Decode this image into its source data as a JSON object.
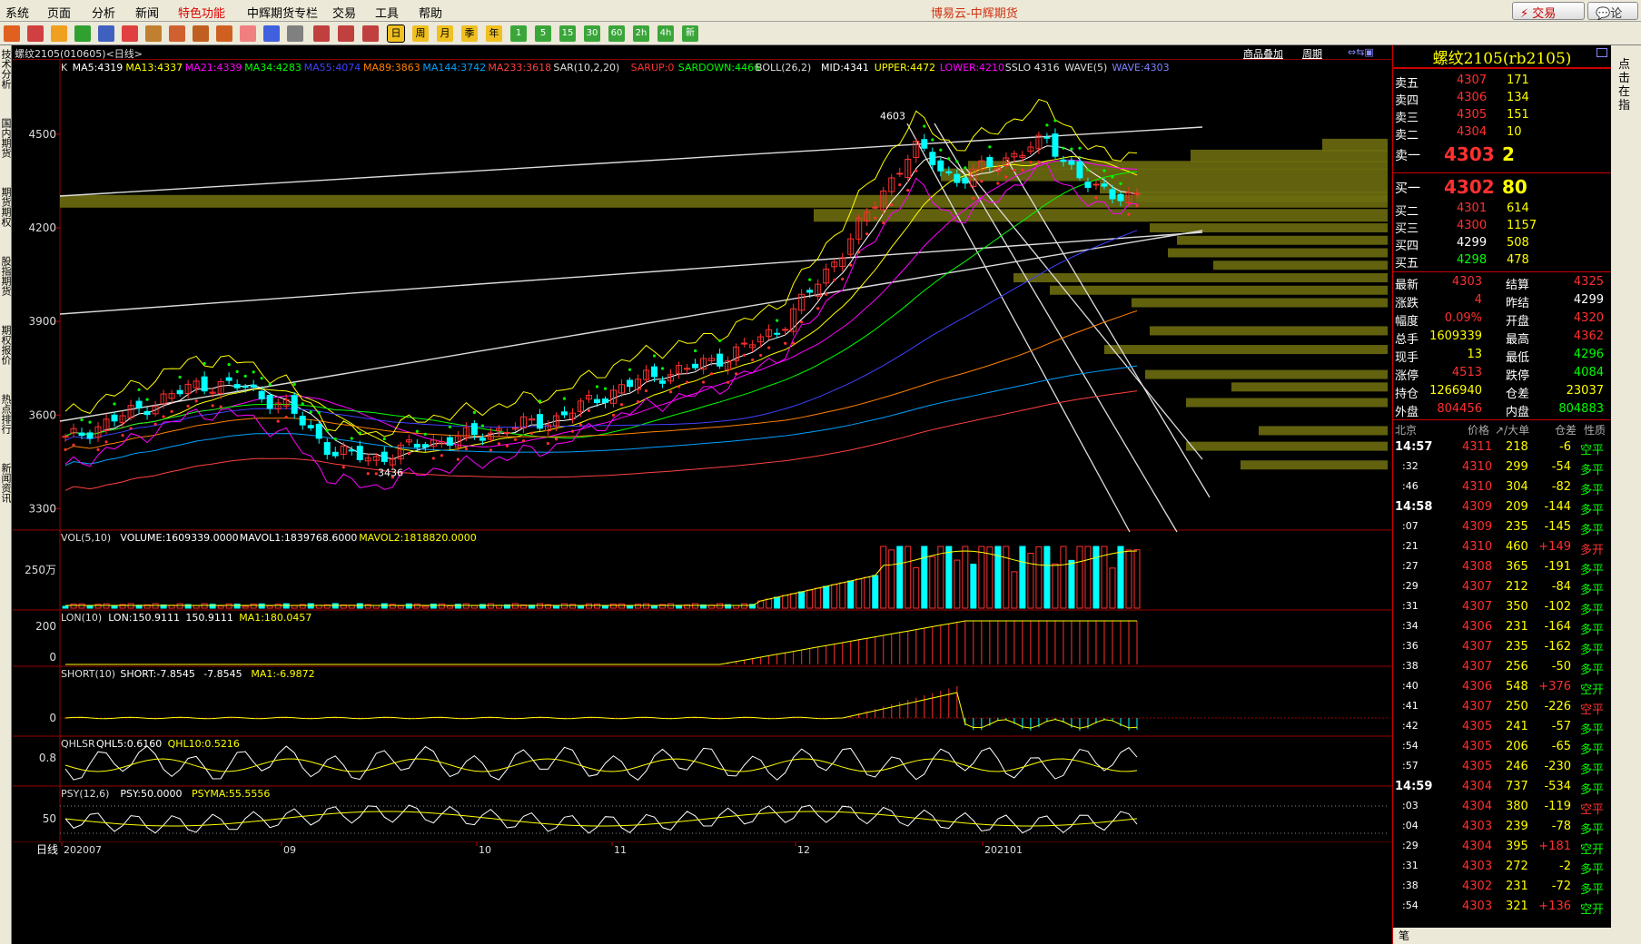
{
  "menu": [
    "系统",
    "页面",
    "分析",
    "新闻",
    "特色功能",
    "中辉期货专栏",
    "交易",
    "工具",
    "帮助"
  ],
  "app_title": "博易云-中辉期货",
  "top_buttons": {
    "trade": "交易",
    "forum": "论坛"
  },
  "toolbar_labels": [
    "日",
    "周",
    "月",
    "季",
    "年",
    "1",
    "5",
    "15",
    "30",
    "60",
    "2h",
    "4h",
    "新"
  ],
  "left_tabs": [
    "技术分析",
    "国内期货",
    "期货期权",
    "股指期货",
    "期权报价",
    "热点排行",
    "新闻资讯"
  ],
  "chart_header": {
    "symbol": "螺纹2105(010605)<日线>",
    "overlay": "商品叠加",
    "period": "周期"
  },
  "indicators": {
    "main": [
      {
        "t": "K",
        "c": "#dddddd"
      },
      {
        "t": "MA5:4319",
        "c": "#ffffff"
      },
      {
        "t": "MA13:4337",
        "c": "#ffff00"
      },
      {
        "t": "MA21:4339",
        "c": "#ff00ff"
      },
      {
        "t": "MA34:4283",
        "c": "#00ff00"
      },
      {
        "t": "MA55:4074",
        "c": "#4040ff"
      },
      {
        "t": "MA89:3863",
        "c": "#ff8000"
      },
      {
        "t": "MA144:3742",
        "c": "#00a0ff"
      },
      {
        "t": "MA233:3618",
        "c": "#ff4040"
      },
      {
        "t": "SAR(10,2,20)",
        "c": "#dddddd"
      },
      {
        "t": "SARUP:0",
        "c": "#ff3030"
      },
      {
        "t": "SARDOWN:4466",
        "c": "#00ff00"
      },
      {
        "t": "BOLL(26,2)",
        "c": "#dddddd"
      },
      {
        "t": "MID:4341",
        "c": "#ffffff"
      },
      {
        "t": "UPPER:4472",
        "c": "#ffff00"
      },
      {
        "t": "LOWER:4210",
        "c": "#ff00ff"
      },
      {
        "t": "SSLO 4316",
        "c": "#dddddd"
      },
      {
        "t": "WAVE(5)",
        "c": "#dddddd"
      },
      {
        "t": "WAVE:4303",
        "c": "#8080ff"
      }
    ],
    "vol": [
      {
        "t": "VOL(5,10)",
        "c": "#dddddd"
      },
      {
        "t": "VOLUME:1609339.0000",
        "c": "#ffffff"
      },
      {
        "t": "MAVOL1:1839768.6000",
        "c": "#ffffff"
      },
      {
        "t": "MAVOL2:1818820.0000",
        "c": "#ffff00"
      }
    ],
    "lon": [
      {
        "t": "LON(10)",
        "c": "#dddddd"
      },
      {
        "t": "LON:150.9111",
        "c": "#ffffff"
      },
      {
        "t": "150.9111",
        "c": "#ffffff"
      },
      {
        "t": "MA1:180.0457",
        "c": "#ffff00"
      }
    ],
    "short": [
      {
        "t": "SHORT(10)",
        "c": "#dddddd"
      },
      {
        "t": "SHORT:-7.8545",
        "c": "#ffffff"
      },
      {
        "t": "-7.8545",
        "c": "#ffffff"
      },
      {
        "t": "MA1:-6.9872",
        "c": "#ffff00"
      }
    ],
    "qhlsr": [
      {
        "t": "QHLSR",
        "c": "#dddddd"
      },
      {
        "t": "QHL5:0.6160",
        "c": "#ffffff"
      },
      {
        "t": "QHL10:0.5216",
        "c": "#ffff00"
      }
    ],
    "psy": [
      {
        "t": "PSY(12,6)",
        "c": "#dddddd"
      },
      {
        "t": "PSY:50.0000",
        "c": "#ffffff"
      },
      {
        "t": "PSYMA:55.5556",
        "c": "#ffff00"
      }
    ]
  },
  "axis": {
    "price_ticks": [
      "4500",
      "4200",
      "3900",
      "3600",
      "3300"
    ],
    "vol_tick": "250万",
    "lon_ticks": [
      "200",
      "0"
    ],
    "short_tick": "0",
    "qhlsr_tick": "0.8",
    "psy_tick": "50",
    "date_label": "日线",
    "dates": [
      "202007",
      "09",
      "10",
      "11",
      "12",
      "202101"
    ],
    "high_label": "4603",
    "low_label": "3436"
  },
  "quote": {
    "title": "螺纹2105(rb2105)",
    "asks": [
      {
        "label": "卖五",
        "price": "4307",
        "vol": "171"
      },
      {
        "label": "卖四",
        "price": "4306",
        "vol": "134"
      },
      {
        "label": "卖三",
        "price": "4305",
        "vol": "151"
      },
      {
        "label": "卖二",
        "price": "4304",
        "vol": "10"
      },
      {
        "label": "卖一",
        "price": "4303",
        "vol": "2"
      }
    ],
    "bids": [
      {
        "label": "买一",
        "price": "4302",
        "vol": "80"
      },
      {
        "label": "买二",
        "price": "4301",
        "vol": "614"
      },
      {
        "label": "买三",
        "price": "4300",
        "vol": "1157"
      },
      {
        "label": "买四",
        "price": "4299",
        "vol": "508"
      },
      {
        "label": "买五",
        "price": "4298",
        "vol": "478"
      }
    ],
    "stats": [
      {
        "l1": "最新",
        "v1": "4303",
        "c1": "#ff3030",
        "l2": "结算",
        "v2": "4325",
        "c2": "#ff3030"
      },
      {
        "l1": "涨跌",
        "v1": "4",
        "c1": "#ff3030",
        "l2": "昨结",
        "v2": "4299",
        "c2": "#ffffff"
      },
      {
        "l1": "幅度",
        "v1": "0.09%",
        "c1": "#ff3030",
        "l2": "开盘",
        "v2": "4320",
        "c2": "#ff3030"
      },
      {
        "l1": "总手",
        "v1": "1609339",
        "c1": "#ffff00",
        "l2": "最高",
        "v2": "4362",
        "c2": "#ff3030"
      },
      {
        "l1": "现手",
        "v1": "13",
        "c1": "#ffff00",
        "l2": "最低",
        "v2": "4296",
        "c2": "#00ff00"
      },
      {
        "l1": "涨停",
        "v1": "4513",
        "c1": "#ff3030",
        "l2": "跌停",
        "v2": "4084",
        "c2": "#00ff00"
      },
      {
        "l1": "持仓",
        "v1": "1266940",
        "c1": "#ffff00",
        "l2": "仓差",
        "v2": "23037",
        "c2": "#ffff00"
      },
      {
        "l1": "外盘",
        "v1": "804456",
        "c1": "#ff3030",
        "l2": "内盘",
        "v2": "804883",
        "c2": "#00ff00"
      }
    ],
    "tick_header": [
      "北京",
      "价格",
      "↗/大单",
      "仓差",
      "性质"
    ],
    "ticks": [
      {
        "time": "14:57",
        "price": "4311",
        "vol": "218",
        "oi": "-6",
        "type": "空平",
        "tc": "#00ff00",
        "big": true
      },
      {
        "time": ":32",
        "price": "4310",
        "vol": "299",
        "oi": "-54",
        "type": "多平",
        "tc": "#00ff00",
        "big": false
      },
      {
        "time": ":46",
        "price": "4310",
        "vol": "304",
        "oi": "-82",
        "type": "多平",
        "tc": "#00ff00",
        "big": false
      },
      {
        "time": "14:58",
        "price": "4309",
        "vol": "209",
        "oi": "-144",
        "type": "多平",
        "tc": "#00ff00",
        "big": true
      },
      {
        "time": ":07",
        "price": "4309",
        "vol": "235",
        "oi": "-145",
        "type": "多平",
        "tc": "#00ff00",
        "big": false
      },
      {
        "time": ":21",
        "price": "4310",
        "vol": "460",
        "oi": "+149",
        "type": "多开",
        "tc": "#ff3030",
        "big": false
      },
      {
        "time": ":27",
        "price": "4308",
        "vol": "365",
        "oi": "-191",
        "type": "多平",
        "tc": "#00ff00",
        "big": false
      },
      {
        "time": ":29",
        "price": "4307",
        "vol": "212",
        "oi": "-84",
        "type": "多平",
        "tc": "#00ff00",
        "big": false
      },
      {
        "time": ":31",
        "price": "4307",
        "vol": "350",
        "oi": "-102",
        "type": "多平",
        "tc": "#00ff00",
        "big": false
      },
      {
        "time": ":34",
        "price": "4306",
        "vol": "231",
        "oi": "-164",
        "type": "多平",
        "tc": "#00ff00",
        "big": false
      },
      {
        "time": ":36",
        "price": "4307",
        "vol": "235",
        "oi": "-162",
        "type": "多平",
        "tc": "#00ff00",
        "big": false
      },
      {
        "time": ":38",
        "price": "4307",
        "vol": "256",
        "oi": "-50",
        "type": "多平",
        "tc": "#00ff00",
        "big": false
      },
      {
        "time": ":40",
        "price": "4306",
        "vol": "548",
        "oi": "+376",
        "type": "空开",
        "tc": "#00ff00",
        "big": false
      },
      {
        "time": ":41",
        "price": "4307",
        "vol": "250",
        "oi": "-226",
        "type": "空平",
        "tc": "#ff3030",
        "big": false
      },
      {
        "time": ":42",
        "price": "4305",
        "vol": "241",
        "oi": "-57",
        "type": "多平",
        "tc": "#00ff00",
        "big": false
      },
      {
        "time": ":54",
        "price": "4305",
        "vol": "206",
        "oi": "-65",
        "type": "多平",
        "tc": "#00ff00",
        "big": false
      },
      {
        "time": ":57",
        "price": "4305",
        "vol": "246",
        "oi": "-230",
        "type": "多平",
        "tc": "#00ff00",
        "big": false
      },
      {
        "time": "14:59",
        "price": "4304",
        "vol": "737",
        "oi": "-534",
        "type": "多平",
        "tc": "#00ff00",
        "big": true
      },
      {
        "time": ":03",
        "price": "4304",
        "vol": "380",
        "oi": "-119",
        "type": "空平",
        "tc": "#ff3030",
        "big": false
      },
      {
        "time": ":04",
        "price": "4303",
        "vol": "239",
        "oi": "-78",
        "type": "多平",
        "tc": "#00ff00",
        "big": false
      },
      {
        "time": ":29",
        "price": "4304",
        "vol": "395",
        "oi": "+181",
        "type": "空开",
        "tc": "#00ff00",
        "big": false
      },
      {
        "time": ":31",
        "price": "4303",
        "vol": "272",
        "oi": "-2",
        "type": "多平",
        "tc": "#00ff00",
        "big": false
      },
      {
        "time": ":38",
        "price": "4302",
        "vol": "231",
        "oi": "-72",
        "type": "多平",
        "tc": "#00ff00",
        "big": false
      },
      {
        "time": ":54",
        "price": "4303",
        "vol": "321",
        "oi": "+136",
        "type": "空开",
        "tc": "#00ff00",
        "big": false
      }
    ],
    "footer": "笔"
  },
  "right_strip": "点击在指",
  "chart_data": {
    "type": "line",
    "title": "螺纹2105(010605)<日线>",
    "x": [
      "202007",
      "09",
      "10",
      "11",
      "12",
      "202101"
    ],
    "ylim": [
      3300,
      4603
    ],
    "series": [
      {
        "name": "K close (approx)",
        "values": [
          3520,
          3580,
          3640,
          3700,
          3690,
          3620,
          3480,
          3460,
          3510,
          3530,
          3560,
          3590,
          3660,
          3720,
          3750,
          3800,
          3880,
          4050,
          4250,
          4460,
          4350,
          4420,
          4480,
          4320,
          4303
        ]
      }
    ]
  }
}
